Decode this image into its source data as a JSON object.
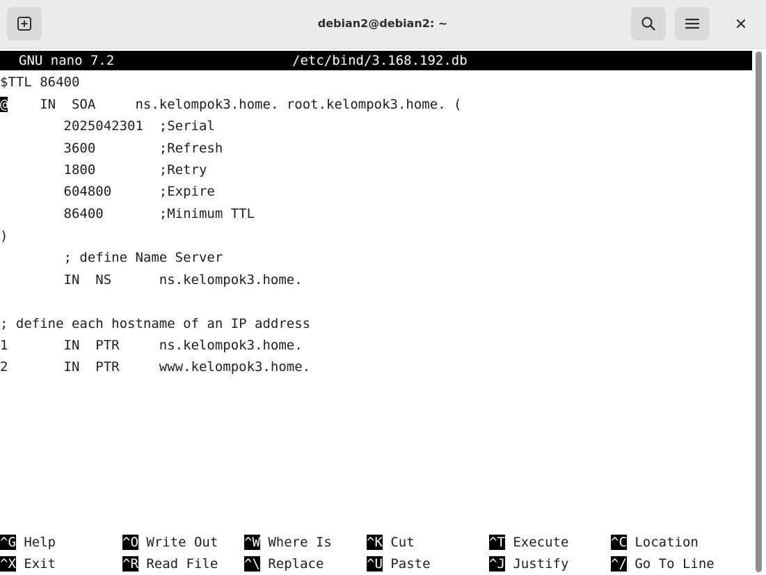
{
  "window": {
    "title": "debian2@debian2: ~"
  },
  "nano": {
    "version": "GNU nano 7.2",
    "filename": "/etc/bind/3.168.192.db",
    "cursor_char": "@",
    "lines": [
      "$TTL 86400",
      "    IN  SOA     ns.kelompok3.home. root.kelompok3.home. (",
      "        2025042301  ;Serial",
      "        3600        ;Refresh",
      "        1800        ;Retry",
      "        604800      ;Expire",
      "        86400       ;Minimum TTL",
      ")",
      "        ; define Name Server",
      "        IN  NS      ns.kelompok3.home.",
      "",
      "; define each hostname of an IP address",
      "1       IN  PTR     ns.kelompok3.home.",
      "2       IN  PTR     www.kelompok3.home."
    ]
  },
  "shortcuts": [
    {
      "key": "^G",
      "label": " Help"
    },
    {
      "key": "^O",
      "label": " Write Out"
    },
    {
      "key": "^W",
      "label": " Where Is"
    },
    {
      "key": "^K",
      "label": " Cut"
    },
    {
      "key": "^T",
      "label": " Execute"
    },
    {
      "key": "^C",
      "label": " Location"
    },
    {
      "key": "^X",
      "label": " Exit"
    },
    {
      "key": "^R",
      "label": " Read File"
    },
    {
      "key": "^\\",
      "label": " Replace"
    },
    {
      "key": "^U",
      "label": " Paste"
    },
    {
      "key": "^J",
      "label": " Justify"
    },
    {
      "key": "^/",
      "label": " Go To Line"
    }
  ],
  "icons": {
    "new_tab": "new-tab-icon",
    "search": "search-icon",
    "menu": "hamburger-menu-icon",
    "close": "close-icon"
  }
}
